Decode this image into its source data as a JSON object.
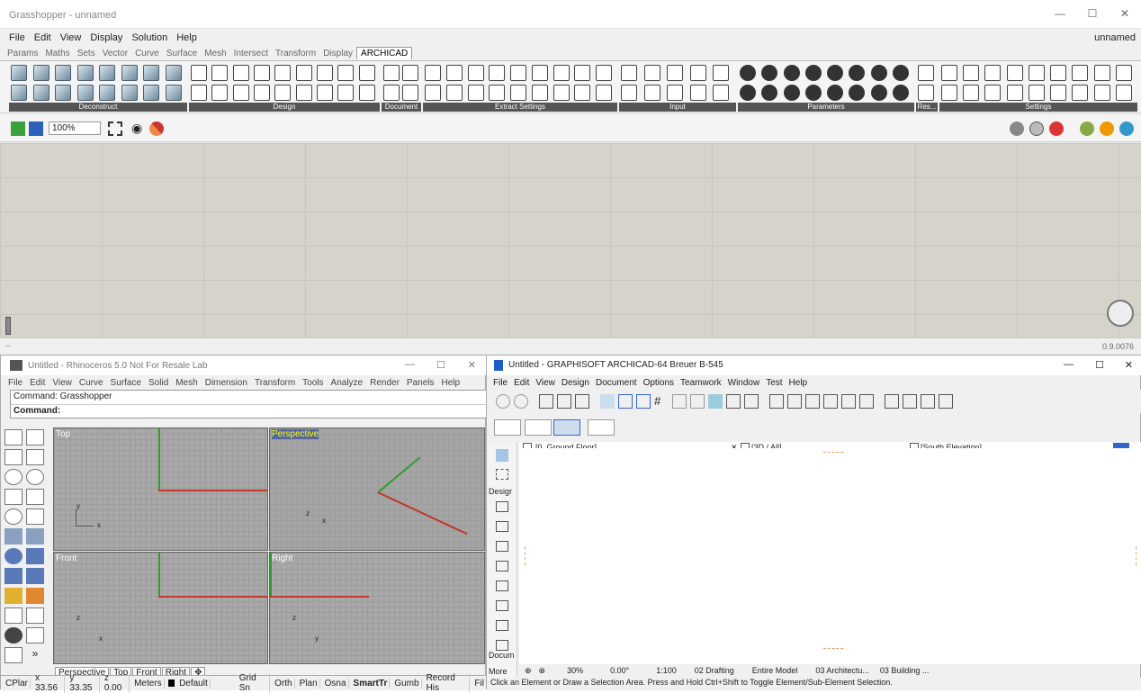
{
  "grasshopper": {
    "title": "Grasshopper - unnamed",
    "menu": [
      "File",
      "Edit",
      "View",
      "Display",
      "Solution",
      "Help"
    ],
    "doc_name": "unnamed",
    "tabs": [
      "Params",
      "Maths",
      "Sets",
      "Vector",
      "Curve",
      "Surface",
      "Mesh",
      "Intersect",
      "Transform",
      "Display",
      "ARCHICAD"
    ],
    "active_tab": "ARCHICAD",
    "ribbon_groups": [
      "Deconstruct",
      "Design",
      "Document",
      "Extract Settings",
      "Input",
      "Parameters",
      "Res...",
      "Settings"
    ],
    "zoom": "100%",
    "version": "0.9.0076"
  },
  "rhino": {
    "title": "Untitled - Rhinoceros 5.0 Not For Resale Lab",
    "menu": [
      "File",
      "Edit",
      "View",
      "Curve",
      "Surface",
      "Solid",
      "Mesh",
      "Dimension",
      "Transform",
      "Tools",
      "Analyze",
      "Render",
      "Panels",
      "Help"
    ],
    "command_history": "Command: Grasshopper",
    "command_prompt": "Command:",
    "viewports": {
      "top": "Top",
      "perspective": "Perspective",
      "front": "Front",
      "right": "Right"
    },
    "viewport_tabs": [
      "Perspective",
      "Top",
      "Front",
      "Right"
    ],
    "status": [
      "CPlar",
      "x 33.56",
      "y 33.35",
      "z 0.00",
      "Meters",
      "Default",
      "Grid Sn",
      "Orth",
      "Plan",
      "Osna",
      "SmartTr",
      "Gumb",
      "Record His",
      "Fil"
    ]
  },
  "archicad": {
    "title": "Untitled - GRAPHISOFT ARCHICAD-64 Breuer B-545",
    "menu": [
      "File",
      "Edit",
      "View",
      "Design",
      "Document",
      "Options",
      "Teamwork",
      "Window",
      "Test",
      "Help"
    ],
    "tabs": [
      "[0. Ground Floor]",
      "[3D / All]",
      "[South Elevation]"
    ],
    "toolbox_labels": {
      "design": "Desigr",
      "document": "Docum",
      "more": "More"
    },
    "bottom_bar": [
      "30%",
      "0.00°",
      "1:100",
      "02 Drafting",
      "Entire Model",
      "03 Architectu...",
      "03 Building ..."
    ],
    "status": "Click an Element or Draw a Selection Area. Press and Hold Ctrl+Shift to Toggle Element/Sub-Element Selection."
  },
  "colors": {
    "gh_canvas": "#d6d3cb",
    "rhino_viewport": "#a9a9a9",
    "accent_red": "#c0392b",
    "accent_green": "#2e9e2e"
  }
}
